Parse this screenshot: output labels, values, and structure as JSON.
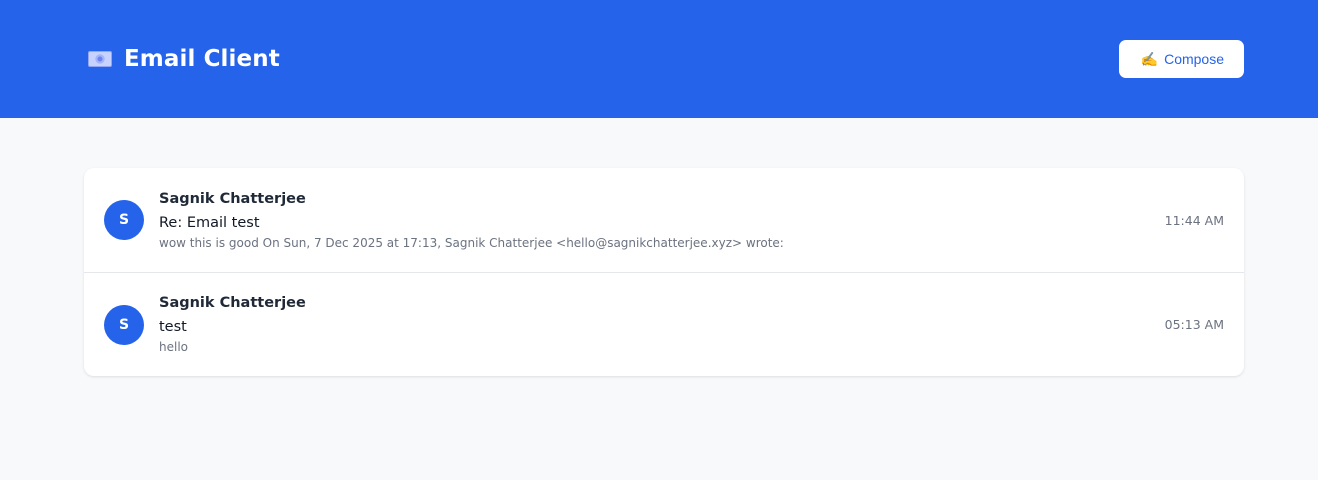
{
  "header": {
    "icon": "email-icon",
    "title": "Email Client",
    "compose_icon": "pen-icon",
    "compose_glyph": "✍️",
    "compose_label": "Compose"
  },
  "emails": [
    {
      "avatar": "S",
      "sender": "Sagnik Chatterjee",
      "subject": "Re: Email test",
      "preview": "wow this is good On Sun, 7 Dec 2025 at 17:13, Sagnik Chatterjee <hello@sagnikchatterjee.xyz> wrote:",
      "time": "11:44 AM"
    },
    {
      "avatar": "S",
      "sender": "Sagnik Chatterjee",
      "subject": "test",
      "preview": "hello",
      "time": "05:13 AM"
    }
  ],
  "colors": {
    "accent": "#2563eb",
    "background": "#f8f9fb"
  }
}
